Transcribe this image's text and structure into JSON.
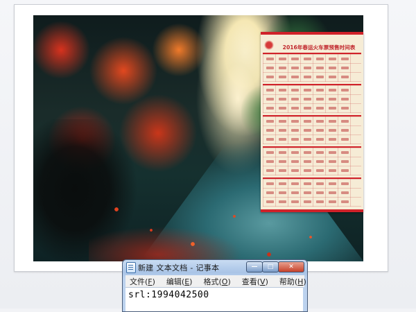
{
  "poster": {
    "title": "2016年春运火车票预售时间表"
  },
  "notepad": {
    "title": "新建 文本文档 - 记事本",
    "window_controls": {
      "minimize": "—",
      "maximize": "□",
      "close": "✕"
    },
    "menu": [
      {
        "label": "文件(F)",
        "base": "文件(",
        "key": "F",
        "tail": ")"
      },
      {
        "label": "编辑(E)",
        "base": "编辑(",
        "key": "E",
        "tail": ")"
      },
      {
        "label": "格式(O)",
        "base": "格式(",
        "key": "O",
        "tail": ")"
      },
      {
        "label": "查看(V)",
        "base": "查看(",
        "key": "V",
        "tail": ")"
      },
      {
        "label": "帮助(H)",
        "base": "帮助(",
        "key": "H",
        "tail": ")"
      }
    ],
    "content": "srl:1994042500"
  },
  "icons": {
    "app": "notepad-icon",
    "minimize": "minimize-icon",
    "maximize": "maximize-icon",
    "close": "close-icon"
  }
}
